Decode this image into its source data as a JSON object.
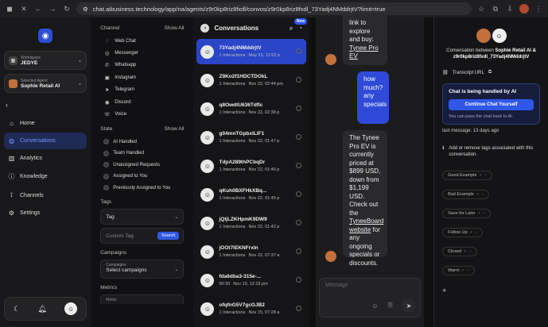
{
  "browser": {
    "url": "chat.aibusiness.technology/app/na/agents/z9r0kp8riz8fxdl/convos/z9r0kp8riz8fxdl_73Yadj4NMddrjtV?limit=true"
  },
  "sidebar": {
    "workspace_label": "Workspace",
    "workspace_name": "JEDYE",
    "agent_label": "Selected Agent",
    "agent_name": "Sophie Retail AI",
    "nav": [
      {
        "label": "Home",
        "icon": "home-icon",
        "active": false
      },
      {
        "label": "Conversations",
        "icon": "chat-icon",
        "active": true
      },
      {
        "label": "Analytics",
        "icon": "chart-icon",
        "active": false
      },
      {
        "label": "Knowledge",
        "icon": "info-icon",
        "active": false
      },
      {
        "label": "Channels",
        "icon": "channels-icon",
        "active": false
      },
      {
        "label": "Settings",
        "icon": "gear-icon",
        "active": false
      }
    ]
  },
  "filters": {
    "channel_heading": "Channel",
    "show_all": "Show All",
    "channels": [
      {
        "label": "Web Chat",
        "icon": "webchat-icon",
        "glyph": "◌"
      },
      {
        "label": "Messenger",
        "icon": "messenger-icon",
        "glyph": "◎"
      },
      {
        "label": "Whatsapp",
        "icon": "whatsapp-icon",
        "glyph": "✆"
      },
      {
        "label": "Instagram",
        "icon": "instagram-icon",
        "glyph": "▣"
      },
      {
        "label": "Telegram",
        "icon": "telegram-icon",
        "glyph": "➤"
      },
      {
        "label": "Discord",
        "icon": "discord-icon",
        "glyph": "◉"
      },
      {
        "label": "Voice",
        "icon": "phone-icon",
        "glyph": "☏"
      }
    ],
    "state_heading": "State",
    "states": [
      "AI Handled",
      "Team Handled",
      "Unassigned Requests",
      "Assigned to You",
      "Previously Assigned to You"
    ],
    "tags_heading": "Tags",
    "tag_select": "Tag",
    "custom_tag_placeholder": "Custom Tag",
    "search_button": "Search",
    "campaigns_heading": "Campaigns",
    "campaigns_small": "Campaigns",
    "campaigns_select": "Select campaigns",
    "metrics_heading": "Metrics",
    "metric_select": "Metric"
  },
  "convos": {
    "title": "Conversations",
    "new_badge": "New",
    "items": [
      {
        "name": "73Yadj4NMddrjtV",
        "meta": "1 Interactions",
        "date": "May 23, 12:52 p",
        "selected": true
      },
      {
        "name": "Z9Ko2f1HDCTDOkL",
        "meta": "1 Interactions",
        "date": "Nov 22, 02:44 pm",
        "selected": false
      },
      {
        "name": "q8OwdtU636Tdflc",
        "meta": "1 Interactions",
        "date": "Nov 22, 02:38 p",
        "selected": false
      },
      {
        "name": "g04mnTGpbxILlF1",
        "meta": "1 Interactions",
        "date": "Nov 22, 01:47 p",
        "selected": false
      },
      {
        "name": "TdpA289thPCbqDr",
        "meta": "1 Interactions",
        "date": "Nov 22, 01:46 p",
        "selected": false
      },
      {
        "name": "qKuh0BXFHkXBq...",
        "meta": "1 Interactions",
        "date": "Nov 22, 01:45 p",
        "selected": false
      },
      {
        "name": "jQljLZKHpmK9DW9",
        "meta": "1 Interactions",
        "date": "Nov 22, 01:42 p",
        "selected": false
      },
      {
        "name": "jOOt7lEKNFrxIn",
        "meta": "1 Interactions",
        "date": "Nov 22, 07:37 a",
        "selected": false
      },
      {
        "name": "fda6dba3-315e-...",
        "meta": "00:30",
        "date": "Nov 19, 12:19 pm",
        "selected": false
      },
      {
        "name": "ofqfnG5V7gcGJB2",
        "meta": "1 Interactions",
        "date": "Nov 15, 07:28 a",
        "selected": false
      }
    ]
  },
  "chat": {
    "msg1_text": "link to explore and buy:",
    "msg1_link": "Tynee Pro EV",
    "msg2": "how much? any specials",
    "msg3_text": "The Tynee Pro EV is currently priced at $899 USD, down from $1,199 USD. Check out the",
    "msg3_link": "TyneeBoard website",
    "msg3_tail": "for any ongoing specials or discounts.",
    "input_placeholder": "Message"
  },
  "details": {
    "title_prefix": "Conversation between",
    "title_agent": "Sophie Retail AI",
    "title_and": "&",
    "title_convo": "z9r0kp8riz8fxdl_73Yadj4NMddrjtV",
    "transcript": "Transcript URL",
    "handle_title": "Chat is being handled by AI",
    "continue_button": "Continue Chat Yourself",
    "handle_sub": "You can pass the chat back to AI.",
    "last_message": "last message: 13 days ago",
    "tags_info": "Add or remove tags associated with this conversation.",
    "tags": [
      "Good Example",
      "Bad Example",
      "Save for Later",
      "Follow Up",
      "Closed",
      "Warm"
    ]
  },
  "colors": {
    "accent": "#2f57e8",
    "selected": "#2a45c7"
  }
}
